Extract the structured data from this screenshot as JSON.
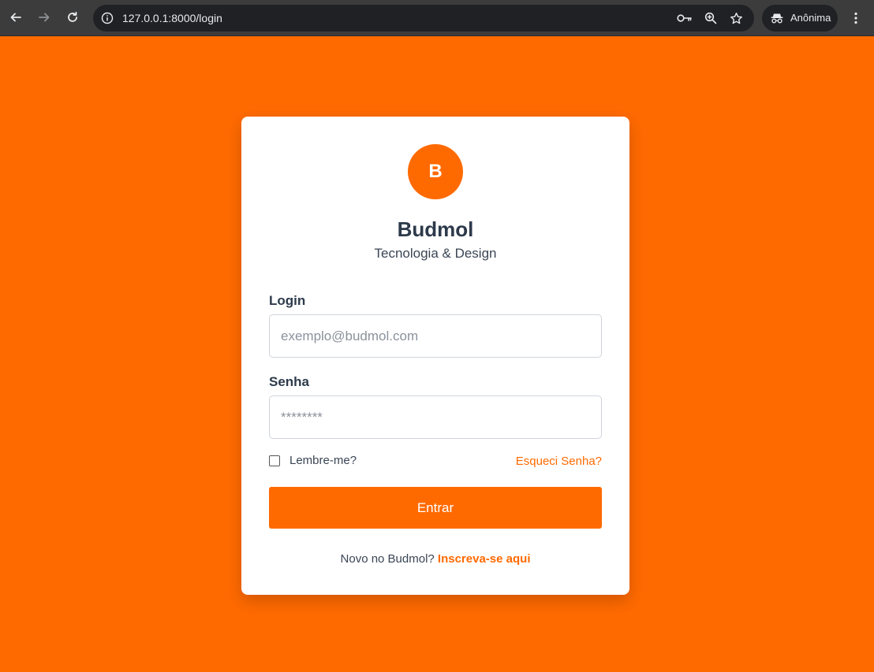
{
  "browser": {
    "url": "127.0.0.1:8000/login",
    "profile_label": "Anônima",
    "icons": [
      "back-arrow-icon",
      "forward-arrow-icon",
      "reload-icon",
      "info-icon",
      "key-icon",
      "zoom-icon",
      "star-icon",
      "incognito-icon",
      "kebab-menu-icon"
    ]
  },
  "login_card": {
    "logo_letter": "B",
    "brand_name": "Budmol",
    "tagline": "Tecnologia & Design",
    "login_label": "Login",
    "login_placeholder": "exemplo@budmol.com",
    "password_label": "Senha",
    "password_placeholder": "********",
    "remember_label": "Lembre-me?",
    "remember_checked": false,
    "forgot_link": "Esqueci Senha?",
    "submit_label": "Entrar",
    "signup_prompt": "Novo no Budmol?",
    "signup_link": "Inscreva-se aqui"
  },
  "colors": {
    "accent": "#ff6a00",
    "text_dark": "#2d3a4b",
    "card_bg": "#ffffff"
  }
}
